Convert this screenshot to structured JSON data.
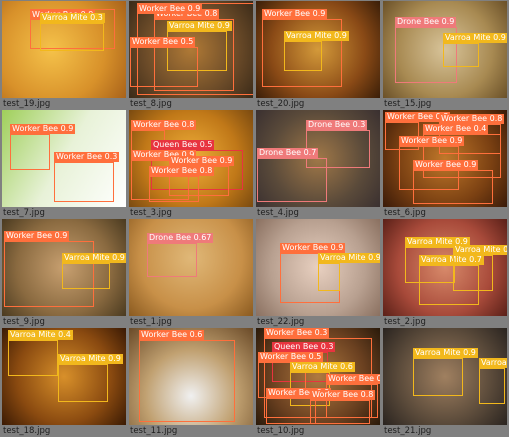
{
  "colors": {
    "Worker Bee": "#ff6f3c",
    "Varroa Mite": "#f2b81c",
    "Queen Bee": "#e8343f",
    "Drone Bee": "#ef7a7a"
  },
  "tiles": [
    {
      "file": "test_19.jpg",
      "bg": "radial-gradient(circle at 40% 50%,#f5c24a,#d8912a 60%,#a8621a)",
      "dets": [
        {
          "cls": "Worker Bee",
          "score": "0.9"
        },
        {
          "cls": "Varroa Mite",
          "score": "0.3"
        }
      ]
    },
    {
      "file": "test_8.jpg",
      "bg": "radial-gradient(circle at 50% 50%,#b07a36,#6a4a28 60%,#3a2a18)",
      "dets": [
        {
          "cls": "Worker Bee",
          "score": "0.8"
        },
        {
          "cls": "Worker Bee",
          "score": "0.9"
        },
        {
          "cls": "Varroa Mite",
          "score": "0.9"
        },
        {
          "cls": "Worker Bee",
          "score": "0.5"
        }
      ]
    },
    {
      "file": "test_20.jpg",
      "bg": "radial-gradient(circle at 50% 50%,#d49a3a,#8a4a16 60%,#3a1e08)",
      "dets": [
        {
          "cls": "Worker Bee",
          "score": "0.9"
        },
        {
          "cls": "Varroa Mite",
          "score": "0.9"
        }
      ]
    },
    {
      "file": "test_15.jpg",
      "bg": "radial-gradient(circle at 50% 50%,#d8c49a,#a88a52 60%,#6a5028)",
      "dets": [
        {
          "cls": "Drone Bee",
          "score": "0.9"
        },
        {
          "cls": "Varroa Mite",
          "score": "0.9"
        }
      ]
    },
    {
      "file": "test_7.jpg",
      "bg": "linear-gradient(120deg,#9fcf5a,#e8f2d8 50%,#ffffff)",
      "dets": [
        {
          "cls": "Worker Bee",
          "score": "0.9"
        },
        {
          "cls": "Worker Bee",
          "score": "0.3"
        }
      ]
    },
    {
      "file": "test_3.jpg",
      "bg": "radial-gradient(circle at 50% 50%,#f0b03a,#c07818 60%,#7a4a10)",
      "dets": [
        {
          "cls": "Worker Bee",
          "score": "0.8"
        },
        {
          "cls": "Queen Bee",
          "score": "0.5"
        },
        {
          "cls": "Worker Bee",
          "score": "0.9"
        },
        {
          "cls": "Worker Bee",
          "score": "0.9"
        },
        {
          "cls": "Worker Bee",
          "score": "0.8"
        }
      ]
    },
    {
      "file": "test_4.jpg",
      "bg": "radial-gradient(circle at 50% 50%,#a07848,#5a4a3a 60%,#3a3030)",
      "dets": [
        {
          "cls": "Drone Bee",
          "score": "0.3"
        },
        {
          "cls": "Drone Bee",
          "score": "0.7"
        }
      ]
    },
    {
      "file": "test_6.jpg",
      "bg": "radial-gradient(circle at 50% 50%,#c0782a,#7a4012 60%,#3a1a08)",
      "dets": [
        {
          "cls": "Worker Bee",
          "score": "0.8"
        },
        {
          "cls": "Worker Bee",
          "score": "0.8"
        },
        {
          "cls": "Worker Bee",
          "score": "0.4"
        },
        {
          "cls": "Worker Bee",
          "score": "0.9"
        },
        {
          "cls": "Worker Bee",
          "score": "0.9"
        }
      ]
    },
    {
      "file": "test_9.jpg",
      "bg": "radial-gradient(circle at 50% 50%,#c8a070,#8a6a40 60%,#4a3a20)",
      "dets": [
        {
          "cls": "Worker Bee",
          "score": "0.9"
        },
        {
          "cls": "Varroa Mite",
          "score": "0.9"
        }
      ]
    },
    {
      "file": "test_1.jpg",
      "bg": "radial-gradient(circle at 50% 40%,#e0b878,#c89048 60%,#8a5a20)",
      "dets": [
        {
          "cls": "Drone Bee",
          "score": "0.67"
        }
      ]
    },
    {
      "file": "test_22.jpg",
      "bg": "radial-gradient(circle at 50% 50%,#e8d0c0,#b8a090 60%,#8a7060)",
      "dets": [
        {
          "cls": "Worker Bee",
          "score": "0.9"
        },
        {
          "cls": "Varroa Mite",
          "score": "0.9"
        }
      ]
    },
    {
      "file": "test_2.jpg",
      "bg": "radial-gradient(circle at 50% 50%,#d88a6a,#a84a3a 60%,#5a2018)",
      "dets": [
        {
          "cls": "Varroa Mite",
          "score": "0.9"
        },
        {
          "cls": "Varroa Mite",
          "score": "0.7"
        },
        {
          "cls": "Varroa Mite",
          "score": "0.8"
        }
      ]
    },
    {
      "file": "test_18.jpg",
      "bg": "radial-gradient(circle at 50% 50%,#d8902a,#8a4a10 60%,#3a1a04)",
      "dets": [
        {
          "cls": "Varroa Mite",
          "score": "0.4"
        },
        {
          "cls": "Varroa Mite",
          "score": "0.9"
        }
      ]
    },
    {
      "file": "test_11.jpg",
      "bg": "radial-gradient(circle at 50% 70%,#f0f0f0,#c0a070 50%,#6a4a28)",
      "dets": [
        {
          "cls": "Worker Bee",
          "score": "0.6"
        }
      ]
    },
    {
      "file": "test_10.jpg",
      "bg": "radial-gradient(circle at 50% 50%,#b07a40,#6a4020 60%,#2a1a0a)",
      "dets": [
        {
          "cls": "Worker Bee",
          "score": "0.3"
        },
        {
          "cls": "Queen Bee",
          "score": "0.3"
        },
        {
          "cls": "Worker Bee",
          "score": "0.5"
        },
        {
          "cls": "Varroa Mite",
          "score": "0.6"
        },
        {
          "cls": "Worker Bee",
          "score": "0.8"
        },
        {
          "cls": "Worker Bee",
          "score": "0.9"
        },
        {
          "cls": "Worker Bee",
          "score": "0.8"
        }
      ]
    },
    {
      "file": "test_21.jpg",
      "bg": "radial-gradient(circle at 50% 50%,#a08060,#5a4a3a 60%,#2a2420)",
      "dets": [
        {
          "cls": "Varroa Mite",
          "score": "0.9"
        },
        {
          "cls": "Varroa Mite",
          "score": "0.9"
        }
      ]
    }
  ]
}
